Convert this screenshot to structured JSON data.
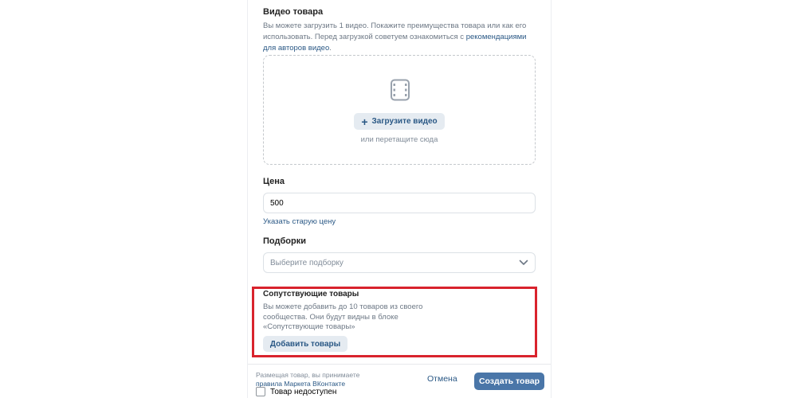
{
  "video": {
    "title": "Видео товара",
    "desc_text": "Вы можете загрузить 1 видео. Покажите преимущества товара или как его использовать. Перед загрузкой советуем ознакомиться с ",
    "desc_link": "рекомендациями для авторов видео",
    "desc_end": ".",
    "upload_label": "Загрузите видео",
    "drop_hint": "или перетащите сюда",
    "icon": "video-file-icon"
  },
  "price": {
    "title": "Цена",
    "value": "500",
    "old_price_link": "Указать старую цену"
  },
  "collections": {
    "title": "Подборки",
    "placeholder": "Выберите подборку",
    "icon": "chevron-down-icon"
  },
  "related": {
    "title": "Сопутствующие товары",
    "desc": "Вы можете добавить до 10 товаров из своего сообщества. Они будут видны в блоке «Сопутствующие товары»",
    "add_label": "Добавить товары",
    "highlight_color": "#d9232d"
  },
  "footer": {
    "terms_text": "Размещая товар, вы принимаете",
    "terms_link": "правила Маркета ВКонтакте",
    "unavailable_label": "Товар недоступен",
    "cancel_label": "Отмена",
    "create_label": "Создать товар"
  },
  "colors": {
    "accent": "#4a76a8",
    "link": "#2a5885",
    "secondary_button_bg": "#e5ebf1"
  }
}
